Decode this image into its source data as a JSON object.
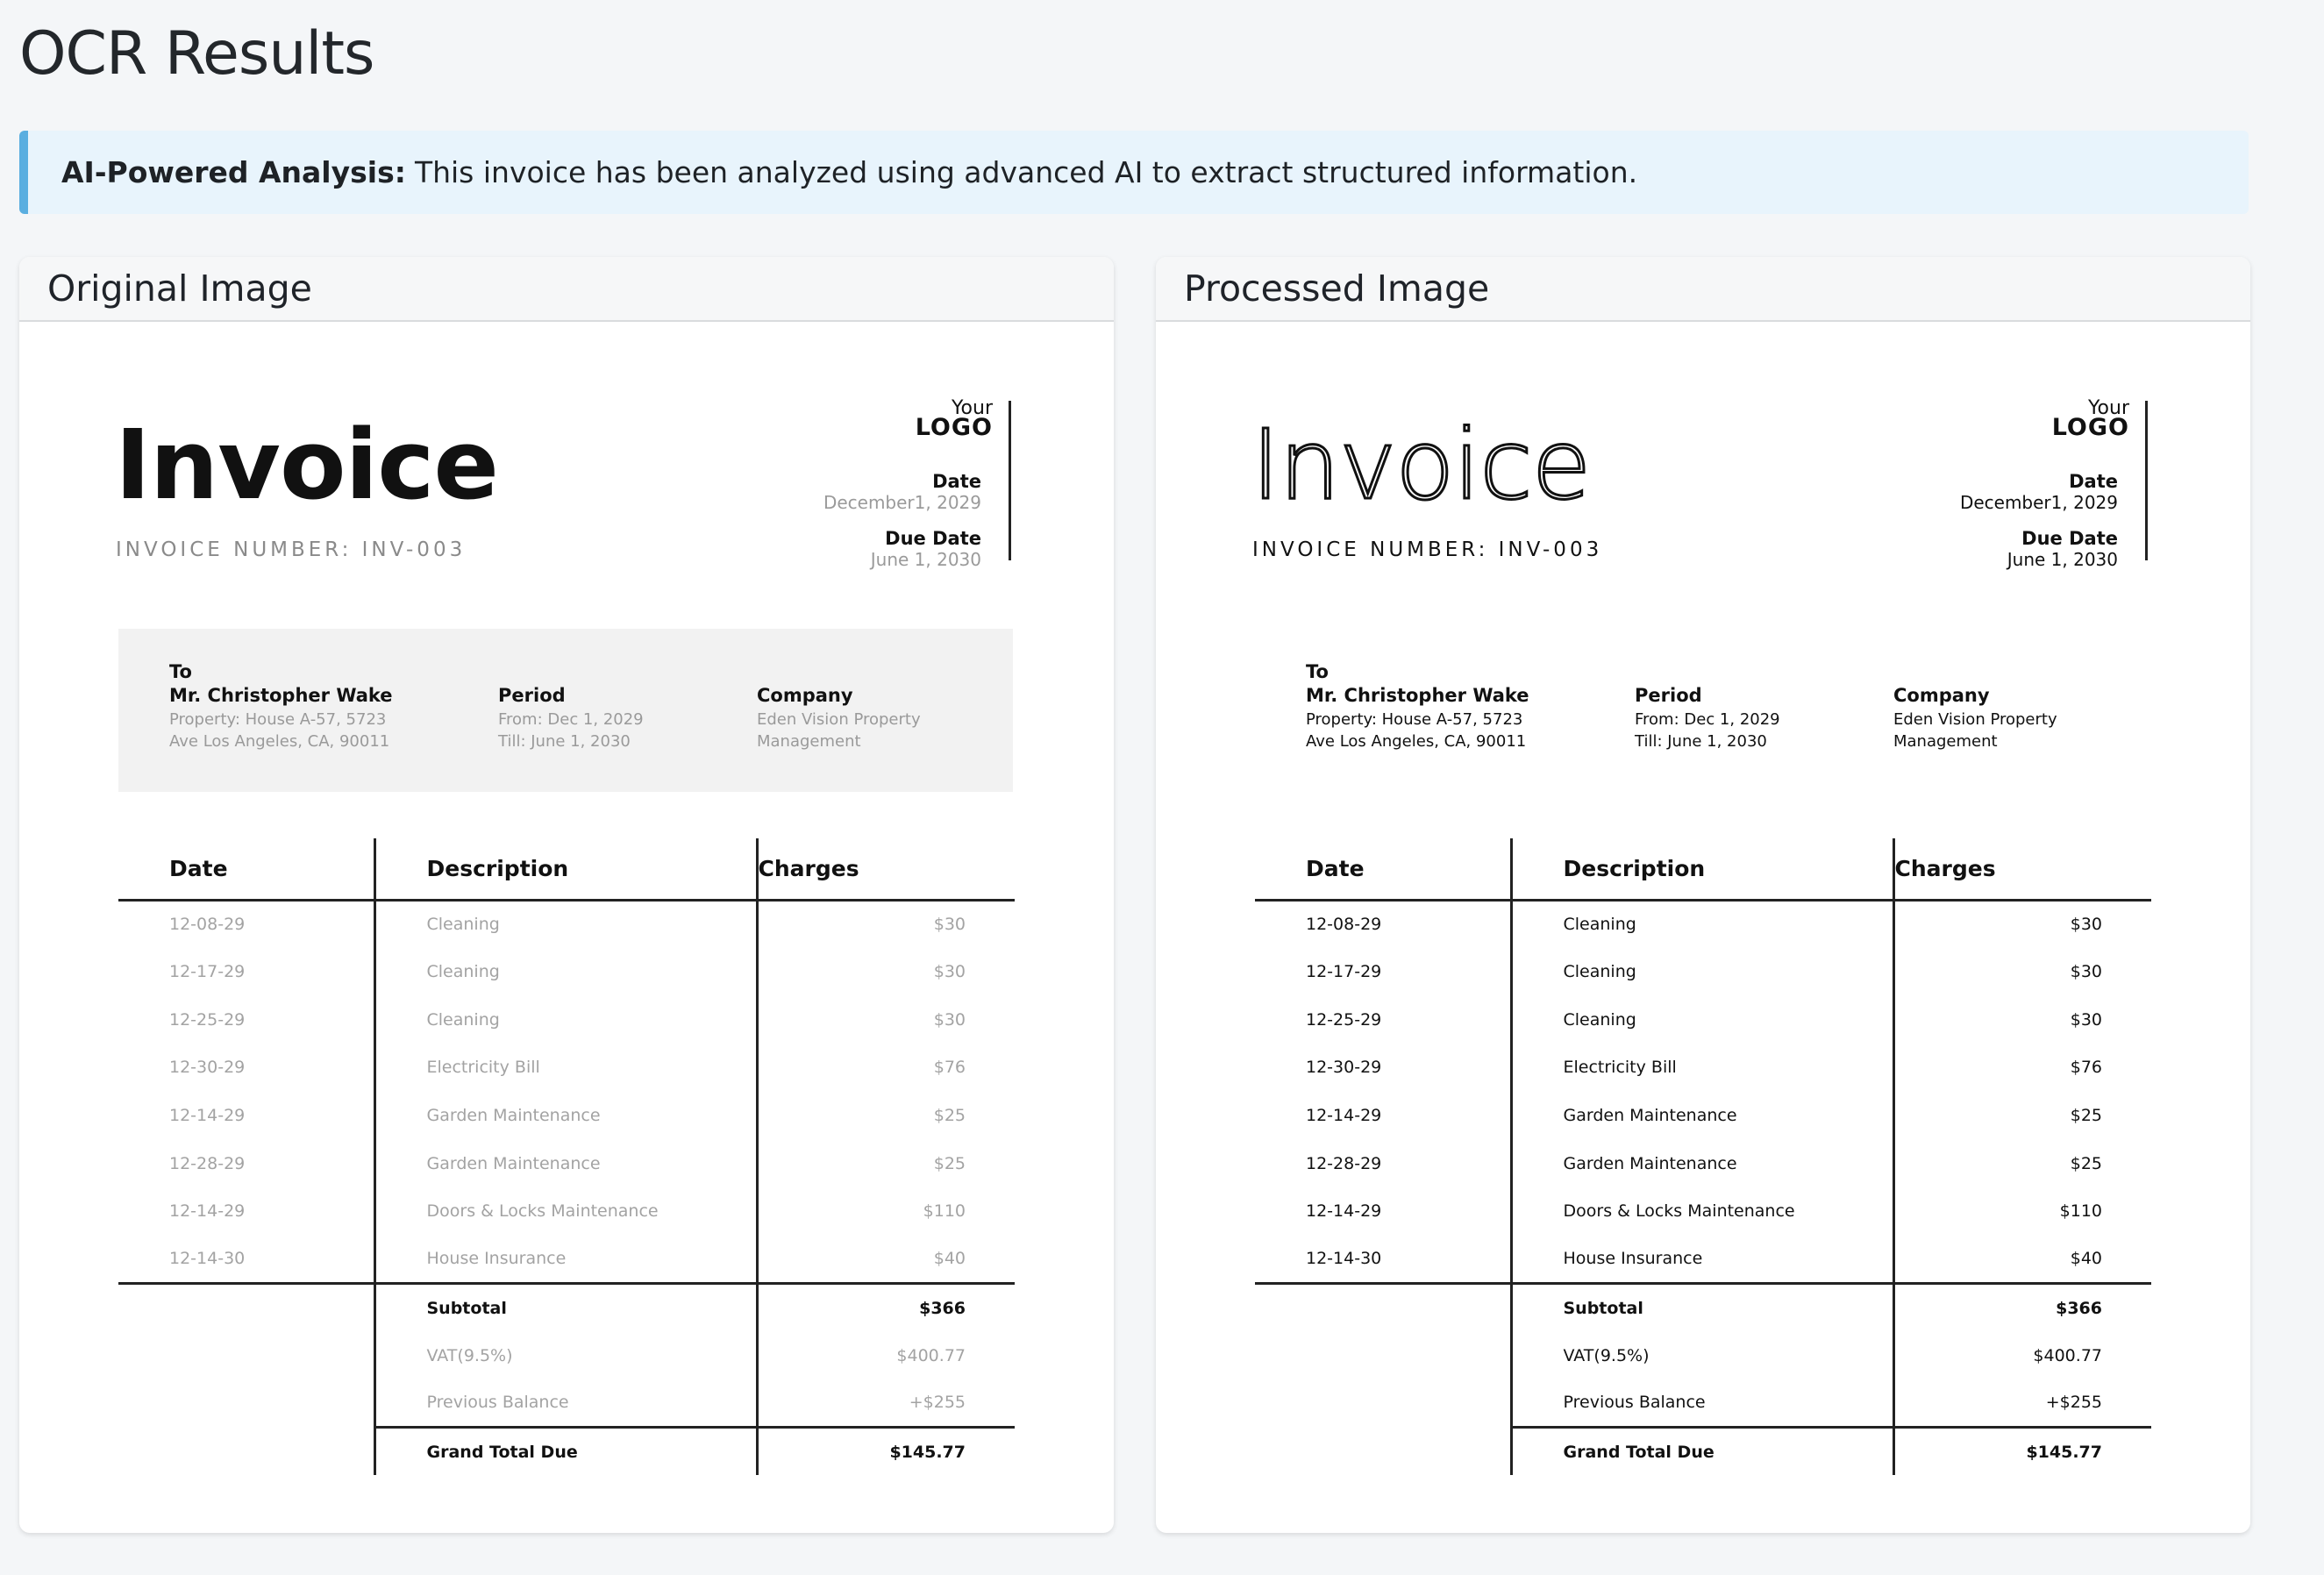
{
  "page": {
    "title": "OCR Results"
  },
  "alert": {
    "strong": "AI-Powered Analysis:",
    "text": "This invoice has been analyzed using advanced AI to extract structured information."
  },
  "panels": {
    "original_title": "Original Image",
    "processed_title": "Processed Image"
  },
  "invoice": {
    "title": "Invoice",
    "number": "INVOICE NUMBER: INV-003",
    "logo_line1": "Your",
    "logo_line2": "LOGO",
    "date_label": "Date",
    "date_value": "December1, 2029",
    "due_label": "Due Date",
    "due_value": "June 1, 2030",
    "to_label": "To",
    "to_name": "Mr. Christopher Wake",
    "to_addr1": "Property:  House A-57, 5723",
    "to_addr2": "Ave Los Angeles, CA, 90011",
    "period_label": "Period",
    "period_from": "From: Dec 1, 2029",
    "period_till": "Till: June 1, 2030",
    "company_label": "Company",
    "company_line1": "Eden Vision Property",
    "company_line2": "Management",
    "col_date": "Date",
    "col_desc": "Description",
    "col_charges": "Charges",
    "items": [
      {
        "date": "12-08-29",
        "desc": "Cleaning",
        "charge": "$30"
      },
      {
        "date": "12-17-29",
        "desc": "Cleaning",
        "charge": "$30"
      },
      {
        "date": "12-25-29",
        "desc": "Cleaning",
        "charge": "$30"
      },
      {
        "date": "12-30-29",
        "desc": "Electricity Bill",
        "charge": "$76"
      },
      {
        "date": "12-14-29",
        "desc": "Garden Maintenance",
        "charge": "$25"
      },
      {
        "date": "12-28-29",
        "desc": "Garden Maintenance",
        "charge": "$25"
      },
      {
        "date": "12-14-29",
        "desc": "Doors & Locks Maintenance",
        "charge": "$110"
      },
      {
        "date": "12-14-30",
        "desc": "House Insurance",
        "charge": "$40"
      }
    ],
    "subtotal_label": "Subtotal",
    "subtotal_value": "$366",
    "vat_label": "VAT(9.5%)",
    "vat_value": "$400.77",
    "prev_label": "Previous Balance",
    "prev_value": "+$255",
    "grand_label": "Grand Total Due",
    "grand_value": "$145.77"
  }
}
